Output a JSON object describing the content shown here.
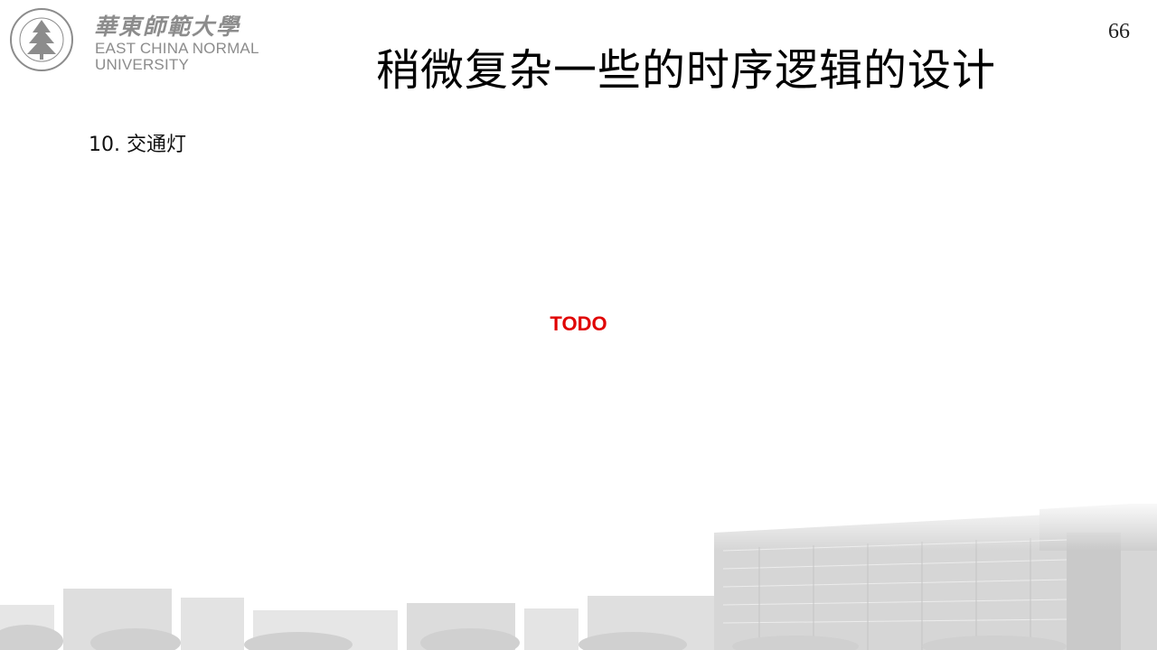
{
  "logo": {
    "cn_name": "華東師範大學",
    "en_line1": "EAST CHINA NORMAL",
    "en_line2": "UNIVERSITY",
    "seal_text": "EAST CHINA NORMAL UNIVERSITY",
    "seal_cn": "華東師範大學"
  },
  "slide": {
    "page_number": "66",
    "title": "稍微复杂一些的时序逻辑的设计",
    "section": "10. 交通灯",
    "placeholder": "TODO"
  },
  "colors": {
    "todo": "#e00000",
    "logo_gray": "#8c8c8c",
    "background_image": "#d9d9d9"
  }
}
